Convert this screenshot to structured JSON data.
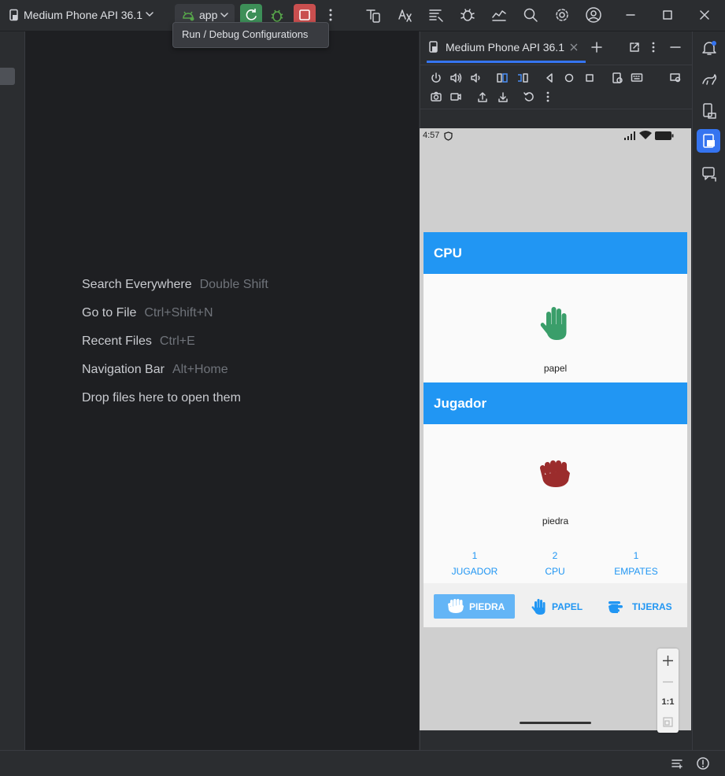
{
  "titlebar": {
    "device_selector": "Medium Phone API 36.1",
    "run_config": "app",
    "tooltip": "Run / Debug Configurations"
  },
  "editor": {
    "hints": [
      {
        "label": "Search Everywhere",
        "key": "Double Shift"
      },
      {
        "label": "Go to File",
        "key": "Ctrl+Shift+N"
      },
      {
        "label": "Recent Files",
        "key": "Ctrl+E"
      },
      {
        "label": "Navigation Bar",
        "key": "Alt+Home"
      },
      {
        "label": "Drop files here to open them",
        "key": ""
      }
    ]
  },
  "panel": {
    "tab_label": "Medium Phone API 36.1"
  },
  "device": {
    "status_time": "4:57",
    "cpu_header": "CPU",
    "cpu_choice": "papel",
    "player_header": "Jugador",
    "player_choice": "piedra",
    "scores": [
      {
        "value": "1",
        "label": "JUGADOR"
      },
      {
        "value": "2",
        "label": "CPU"
      },
      {
        "value": "1",
        "label": "EMPATES"
      }
    ],
    "buttons": [
      {
        "label": "PIEDRA"
      },
      {
        "label": "PAPEL"
      },
      {
        "label": "TIJERAS"
      }
    ]
  },
  "zoom": {
    "one_to_one": "1:1"
  },
  "colors": {
    "accent_blue": "#2196f3",
    "paper_green": "#3a9e6a",
    "rock_red": "#9b2c2c",
    "run_green": "#3d8f58",
    "stop_red": "#c94f4f"
  }
}
